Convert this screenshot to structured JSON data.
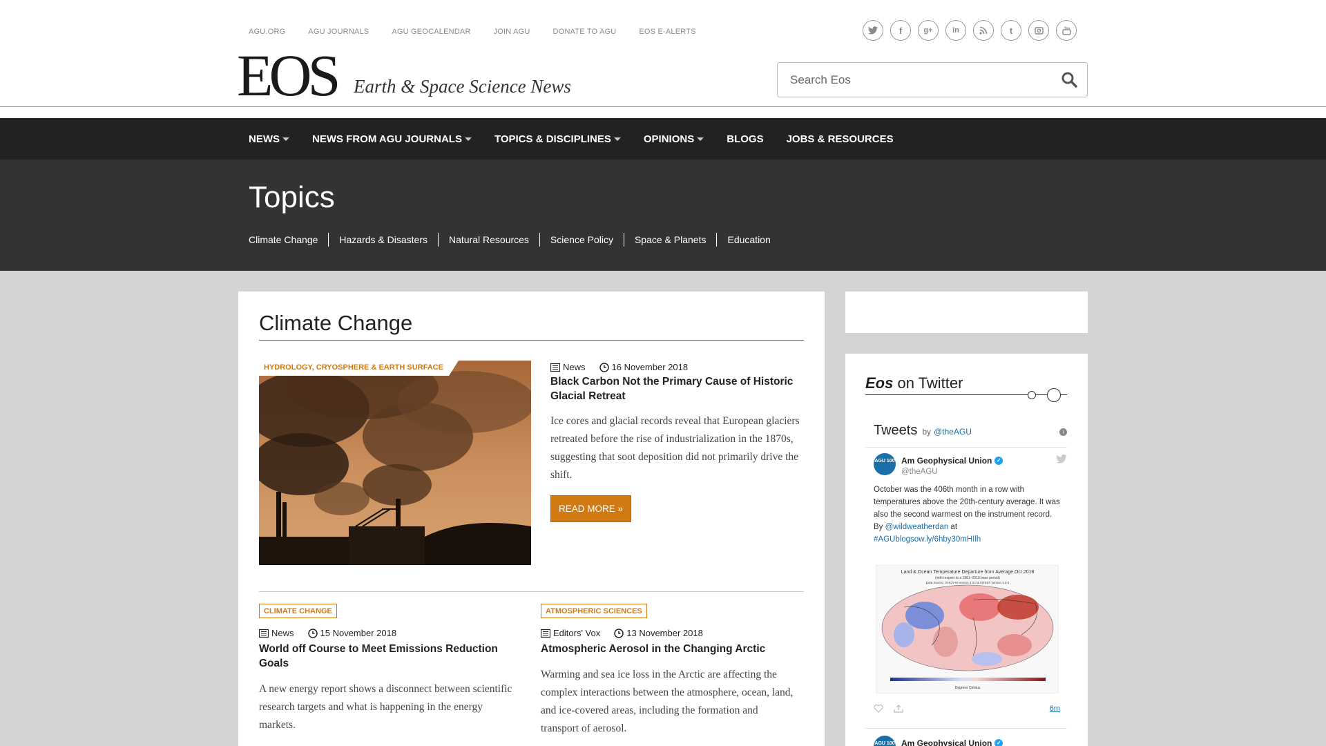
{
  "util_links": [
    "AGU.ORG",
    "AGU JOURNALS",
    "AGU GEOCALENDAR",
    "JOIN AGU",
    "DONATE TO AGU",
    "EOS E-ALERTS"
  ],
  "social_icons": [
    "twitter-icon",
    "facebook-icon",
    "google-plus-icon",
    "linkedin-icon",
    "rss-icon",
    "tumblr-icon",
    "instagram-icon",
    "youtube-icon"
  ],
  "logo": {
    "text": "EOS",
    "tagline": "Earth & Space Science News"
  },
  "search": {
    "placeholder": "Search Eos"
  },
  "nav": [
    {
      "label": "NEWS",
      "dropdown": true
    },
    {
      "label": "NEWS FROM AGU JOURNALS",
      "dropdown": true
    },
    {
      "label": "TOPICS & DISCIPLINES",
      "dropdown": true
    },
    {
      "label": "OPINIONS",
      "dropdown": true
    },
    {
      "label": "BLOGS",
      "dropdown": false
    },
    {
      "label": "JOBS & RESOURCES",
      "dropdown": false
    }
  ],
  "topics": {
    "title": "Topics",
    "links": [
      "Climate Change",
      "Hazards & Disasters",
      "Natural Resources",
      "Science Policy",
      "Space & Planets",
      "Education"
    ]
  },
  "section": {
    "title": "Climate Change"
  },
  "featured": {
    "tag": "HYDROLOGY, CRYOSPHERE & EARTH SURFACE",
    "type": "News",
    "date": "16 November 2018",
    "title": "Black Carbon Not the Primary Cause of Historic Glacial Retreat",
    "excerpt": "Ice cores and glacial records reveal that European glaciers retreated before the rise of industrialization in the 1870s, suggesting that soot deposition did not primarily drive the shift.",
    "read_more": "READ MORE »"
  },
  "articles": [
    {
      "tag": "CLIMATE CHANGE",
      "type": "News",
      "date": "15 November 2018",
      "title": "World off Course to Meet Emissions Reduction Goals",
      "excerpt": "A new energy report shows a disconnect between scientific research targets and what is happening in the energy markets."
    },
    {
      "tag": "ATMOSPHERIC SCIENCES",
      "type": "Editors' Vox",
      "date": "13 November 2018",
      "title": "Atmospheric Aerosol in the Changing Arctic",
      "excerpt": "Warming and sea ice loss in the Arctic are affecting the complex interactions between the atmosphere, ocean, land, and ice-covered areas, including the formation and transport of aerosol."
    }
  ],
  "twitter": {
    "heading_em": "Eos",
    "heading_rest": " on Twitter",
    "widget_title": "Tweets",
    "by": "by",
    "handle": "@theAGU",
    "tweet1": {
      "avatar": "AGU 100",
      "name": "Am Geophysical Union",
      "handle": "@theAGU",
      "text": "October was the 406th month in a row with temperatures above the 20th-century average. It was also the second warmest on the instrument record.",
      "by_label": "By",
      "mention": "@wildweatherdan",
      "at_label": "at",
      "link": "#AGUblogsow.ly/6hby30mHIlh",
      "time": "6m",
      "map_title": "Land & Ocean Temperature Departure from Average Oct 2018",
      "map_sub": "(with respect to a 1981–2010 base period)",
      "map_source": "Data Source: GHCN-M version 3.3.0 & ERSST version 4.0.0",
      "map_axis": "Degrees Celsius"
    },
    "tweet2": {
      "name": "Am Geophysical Union"
    }
  },
  "colors": {
    "accent": "#d17a14",
    "nav_bg": "#222222",
    "topics_bg": "#333333",
    "content_bg": "#d4d4d4"
  }
}
